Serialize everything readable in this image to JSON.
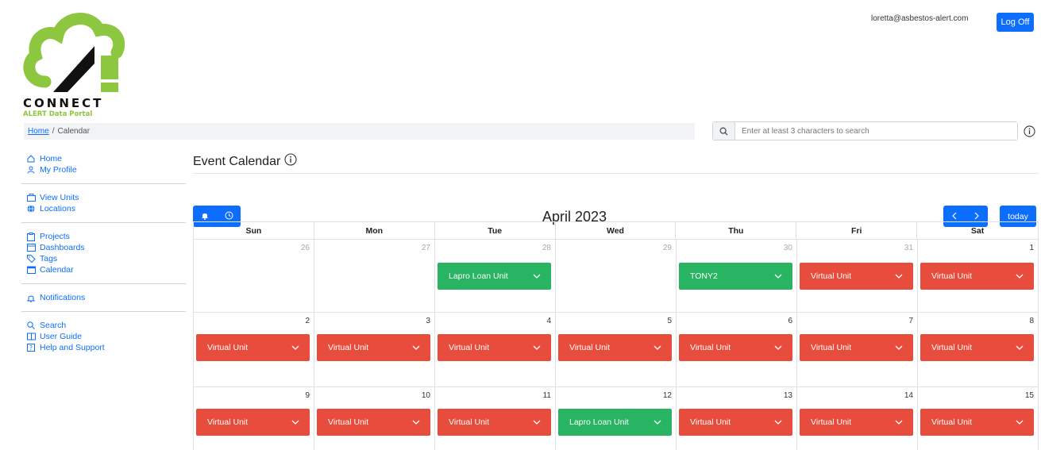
{
  "header": {
    "logo_word": "CONNECT",
    "logo_sub": "ALERT Data Portal",
    "user_email": "loretta@asbestos-alert.com",
    "logoff_label": "Log Off"
  },
  "breadcrumb": {
    "home": "Home",
    "separator": "/",
    "current": "Calendar"
  },
  "search": {
    "placeholder": "Enter at least 3 characters to search"
  },
  "sidebar": {
    "groups": [
      [
        {
          "label": "Home",
          "icon": "house-icon"
        },
        {
          "label": "My Profile",
          "icon": "person-icon"
        }
      ],
      [
        {
          "label": "View Units",
          "icon": "units-icon"
        },
        {
          "label": "Locations",
          "icon": "globe-icon"
        }
      ],
      [
        {
          "label": "Projects",
          "icon": "clipboard-icon"
        },
        {
          "label": "Dashboards",
          "icon": "window-icon"
        },
        {
          "label": "Tags",
          "icon": "tags-icon"
        },
        {
          "label": "Calendar",
          "icon": "calendar-icon"
        }
      ],
      [
        {
          "label": "Notifications",
          "icon": "bell-icon"
        }
      ],
      [
        {
          "label": "Search",
          "icon": "search-icon"
        },
        {
          "label": "User Guide",
          "icon": "book-icon"
        },
        {
          "label": "Help and Support",
          "icon": "question-icon"
        }
      ]
    ]
  },
  "main": {
    "title": "Event Calendar",
    "month_title": "April 2023",
    "today_label": "today"
  },
  "calendar": {
    "weekdays": [
      "Sun",
      "Mon",
      "Tue",
      "Wed",
      "Thu",
      "Fri",
      "Sat"
    ],
    "weeks": [
      [
        {
          "day": "26",
          "other": true,
          "event": null
        },
        {
          "day": "27",
          "other": true,
          "event": null
        },
        {
          "day": "28",
          "other": true,
          "event": {
            "label": "Lapro Loan Unit",
            "status": "green"
          }
        },
        {
          "day": "29",
          "other": true,
          "event": null
        },
        {
          "day": "30",
          "other": true,
          "event": {
            "label": "TONY2",
            "status": "green"
          }
        },
        {
          "day": "31",
          "other": true,
          "event": {
            "label": "Virtual Unit",
            "status": "red"
          }
        },
        {
          "day": "1",
          "other": false,
          "event": {
            "label": "Virtual Unit",
            "status": "red"
          }
        }
      ],
      [
        {
          "day": "2",
          "other": false,
          "event": {
            "label": "Virtual Unit",
            "status": "red"
          }
        },
        {
          "day": "3",
          "other": false,
          "event": {
            "label": "Virtual Unit",
            "status": "red"
          }
        },
        {
          "day": "4",
          "other": false,
          "event": {
            "label": "Virtual Unit",
            "status": "red"
          }
        },
        {
          "day": "5",
          "other": false,
          "event": {
            "label": "Virtual Unit",
            "status": "red"
          }
        },
        {
          "day": "6",
          "other": false,
          "event": {
            "label": "Virtual Unit",
            "status": "red"
          }
        },
        {
          "day": "7",
          "other": false,
          "event": {
            "label": "Virtual Unit",
            "status": "red"
          }
        },
        {
          "day": "8",
          "other": false,
          "event": {
            "label": "Virtual Unit",
            "status": "red"
          }
        }
      ],
      [
        {
          "day": "9",
          "other": false,
          "event": {
            "label": "Virtual Unit",
            "status": "red"
          }
        },
        {
          "day": "10",
          "other": false,
          "event": {
            "label": "Virtual Unit",
            "status": "red"
          }
        },
        {
          "day": "11",
          "other": false,
          "event": {
            "label": "Virtual Unit",
            "status": "red"
          }
        },
        {
          "day": "12",
          "other": false,
          "event": {
            "label": "Lapro Loan Unit",
            "status": "green"
          }
        },
        {
          "day": "13",
          "other": false,
          "event": {
            "label": "Virtual Unit",
            "status": "red"
          }
        },
        {
          "day": "14",
          "other": false,
          "event": {
            "label": "Virtual Unit",
            "status": "red"
          }
        },
        {
          "day": "15",
          "other": false,
          "event": {
            "label": "Virtual Unit",
            "status": "red"
          }
        }
      ]
    ]
  },
  "colors": {
    "accent": "#0d6efd",
    "event_red": "#e74c3c",
    "event_green": "#28b463",
    "logo_green": "#8dc63f"
  }
}
